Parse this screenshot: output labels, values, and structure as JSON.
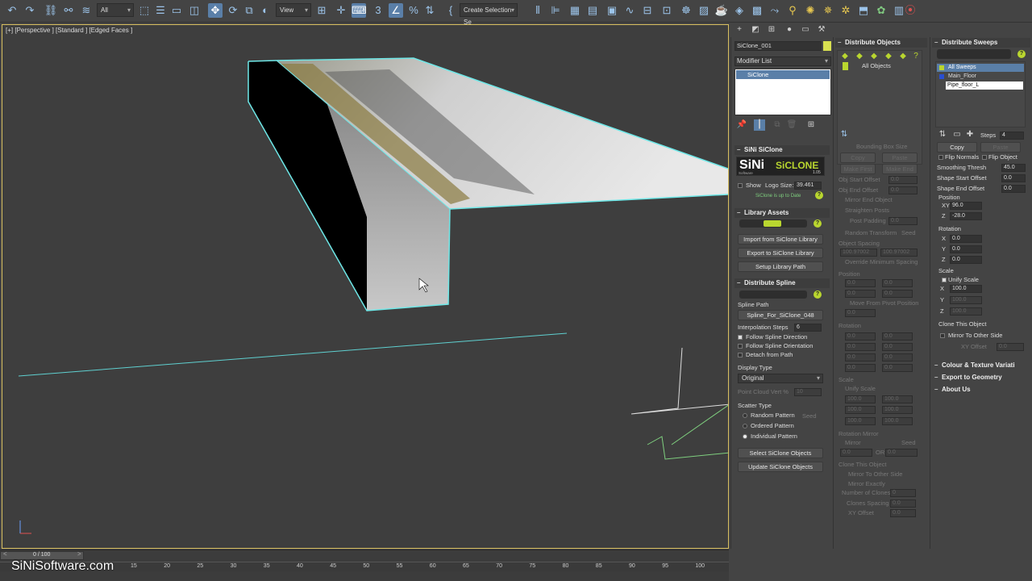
{
  "toolbar": {
    "filter": "All",
    "view": "View",
    "selection_set": "Create Selection Se"
  },
  "viewport": {
    "label": "[+] [Perspective ] [Standard ] [Edged Faces ]"
  },
  "timeline": {
    "frame_counter": "0 / 100",
    "ticks": [
      "15",
      "20",
      "25",
      "30",
      "35",
      "40",
      "45",
      "50",
      "55",
      "60",
      "65",
      "70",
      "75",
      "80",
      "85",
      "90",
      "95",
      "100"
    ],
    "watermark": "SiNiSoftware.com"
  },
  "command_panel": {
    "object_name": "SiClone_001",
    "modifier_list": "Modifier List",
    "modifier_item": "SiClone",
    "siclone_header": "SiNi SiClone",
    "logo_left": "SiNi",
    "logo_sub": "Software",
    "logo_right": "SiCLONE",
    "version": "1.05",
    "show_label": "Show",
    "logo_size_label": "Logo Size:",
    "logo_size_value": "39.461",
    "update_status": "SiClone is up to Date",
    "library_header": "Library Assets",
    "import_btn": "Import from SiClone Library",
    "export_btn": "Export to SiClone Library",
    "setup_btn": "Setup Library Path",
    "distribute_spline_header": "Distribute Spline",
    "spline_path_label": "Spline Path",
    "spline_path_value": "Spline_For_SiClone_048",
    "interp_label": "Interpolation Steps",
    "interp_value": "6",
    "follow_dir": "Follow Spline Direction",
    "follow_orient": "Follow Spline Orientation",
    "detach": "Detach from Path",
    "display_type_label": "Display Type",
    "display_type_value": "Original",
    "point_cloud": "Point Cloud Vert %",
    "point_cloud_value": "10",
    "scatter_label": "Scatter Type",
    "random_pattern": "Random Pattern",
    "seed": "Seed",
    "ordered_pattern": "Ordered Pattern",
    "individual_pattern": "Individual Pattern",
    "select_btn": "Select SiClone Objects",
    "update_btn": "Update SiClone Objects"
  },
  "distribute_objects": {
    "header": "Distribute Objects",
    "all_objects": "All Objects",
    "bbox_size": "Bounding Box Size",
    "copy": "Copy",
    "paste": "Paste",
    "make_first": "Make First",
    "make_end": "Make End",
    "obj_start": "Obj Start Offset",
    "obj_start_val": "0.0",
    "obj_end": "Obj End Offset",
    "obj_end_val": "0.0",
    "mirror_end": "Mirror End Object",
    "straighten": "Straighten Posts",
    "post_padding": "Post Padding",
    "post_padding_val": "0.0",
    "random_transform": "Random Transform",
    "obj_spacing": "Object Spacing",
    "spacing_a": "100.97002",
    "spacing_b": "100.97002",
    "override_spacing": "Override Minimum Spacing",
    "position": "Position",
    "move_pivot": "Move From Pivot Position",
    "rotation": "Rotation",
    "scale": "Scale",
    "unify_scale": "Unify Scale",
    "rotation_mirror": "Rotation Mirror",
    "mirror": "Mirror",
    "or": "OR",
    "clone_this": "Clone This Object",
    "mirror_other": "Mirror To Other Side",
    "mirror_exactly": "Mirror Exactly",
    "num_clones": "Number of Clones",
    "num_clones_val": "0",
    "clones_spacing": "Clones Spacing",
    "clones_spacing_val": "0.0",
    "xy_offset": "XY Offset",
    "xy_offset_val": "0.0",
    "val_zero": "0.0",
    "val_hundred": "100.0"
  },
  "distribute_sweeps": {
    "header": "Distribute Sweeps",
    "list": [
      "All Sweeps",
      "Main_Floor",
      "Pipe_floor_L"
    ],
    "steps_label": "Steps",
    "steps_val": "4",
    "copy": "Copy",
    "paste": "Paste",
    "flip_normals": "Flip Normals",
    "flip_object": "Flip Object",
    "smoothing": "Smoothing Thresh",
    "smoothing_val": "45.0",
    "shape_start": "Shape Start Offset",
    "shape_start_val": "0.0",
    "shape_end": "Shape End Offset",
    "shape_end_val": "0.0",
    "position": "Position",
    "pos_xy": "96.0",
    "pos_z": "-28.0",
    "rotation": "Rotation",
    "rot_val": "0.0",
    "scale": "Scale",
    "unify_scale": "Unify Scale",
    "scale_val": "100.0",
    "clone_this": "Clone This Object",
    "mirror_other": "Mirror To Other Side",
    "xy_offset": "XY Offset",
    "xy_offset_val": "0.0",
    "colour_texture": "Colour & Texture Variati",
    "export_geometry": "Export to Geometry",
    "about": "About Us"
  },
  "colors": {
    "selection": "#6ee7e7",
    "accent_yellow": "#d9c060",
    "highlight_blue": "#5a7fa8",
    "logo_green": "#b9d62f"
  }
}
